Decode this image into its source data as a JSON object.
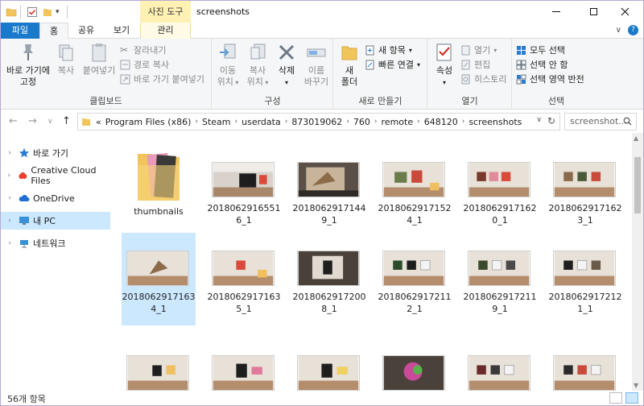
{
  "window": {
    "title": "screenshots",
    "context_tab": "사진 도구"
  },
  "tabs": {
    "file": "파일",
    "home": "홈",
    "share": "공유",
    "view": "보기",
    "manage": "관리"
  },
  "ribbon": {
    "clipboard": {
      "label": "클립보드",
      "pin_line1": "바로 가기에",
      "pin_line2": "고정",
      "copy": "복사",
      "paste": "붙여넣기",
      "cut": "잘라내기",
      "copy_path": "경로 복사",
      "paste_shortcut": "바로 가기 붙여넣기"
    },
    "organize": {
      "label": "구성",
      "move_line1": "이동",
      "move_line2": "위치",
      "copyto_line1": "복사",
      "copyto_line2": "위치",
      "delete": "삭제",
      "rename_line1": "이름",
      "rename_line2": "바꾸기"
    },
    "new": {
      "label": "새로 만들기",
      "new_folder_line1": "새",
      "new_folder_line2": "폴더",
      "new_item": "새 항목",
      "easy_access": "빠른 연결"
    },
    "open": {
      "label": "열기",
      "properties": "속성",
      "open": "열기",
      "edit": "편집",
      "history": "히스토리"
    },
    "select": {
      "label": "선택",
      "select_all": "모두 선택",
      "select_none": "선택 안 함",
      "invert": "선택 영역 반전"
    }
  },
  "address": {
    "crumbs": [
      "Program Files (x86)",
      "Steam",
      "userdata",
      "873019062",
      "760",
      "remote",
      "648120",
      "screenshots"
    ],
    "overflow": "«",
    "search_placeholder": "screenshot..."
  },
  "navpane": {
    "items": [
      {
        "label": "바로 가기",
        "icon": "star-icon"
      },
      {
        "label": "Creative Cloud Files",
        "icon": "creative-cloud-icon"
      },
      {
        "label": "OneDrive",
        "icon": "cloud-icon"
      },
      {
        "label": "내 PC",
        "icon": "pc-icon"
      },
      {
        "label": "네트워크",
        "icon": "network-icon"
      }
    ]
  },
  "files": [
    {
      "name": "thumbnails",
      "folder": true
    },
    {
      "name": "20180629165516_1"
    },
    {
      "name": "20180629171449_1"
    },
    {
      "name": "20180629171524_1"
    },
    {
      "name": "20180629171620_1"
    },
    {
      "name": "20180629171623_1"
    },
    {
      "name": "20180629171634_1"
    },
    {
      "name": "20180629171635_1"
    },
    {
      "name": "20180629172008_1"
    },
    {
      "name": "20180629172112_1"
    },
    {
      "name": "20180629172119_1"
    },
    {
      "name": "20180629172121_1"
    }
  ],
  "status": {
    "count": "56개 항목"
  },
  "colors": {
    "accent": "#1979ca",
    "selection": "#cce8ff",
    "context_tab": "#fff0b3"
  }
}
